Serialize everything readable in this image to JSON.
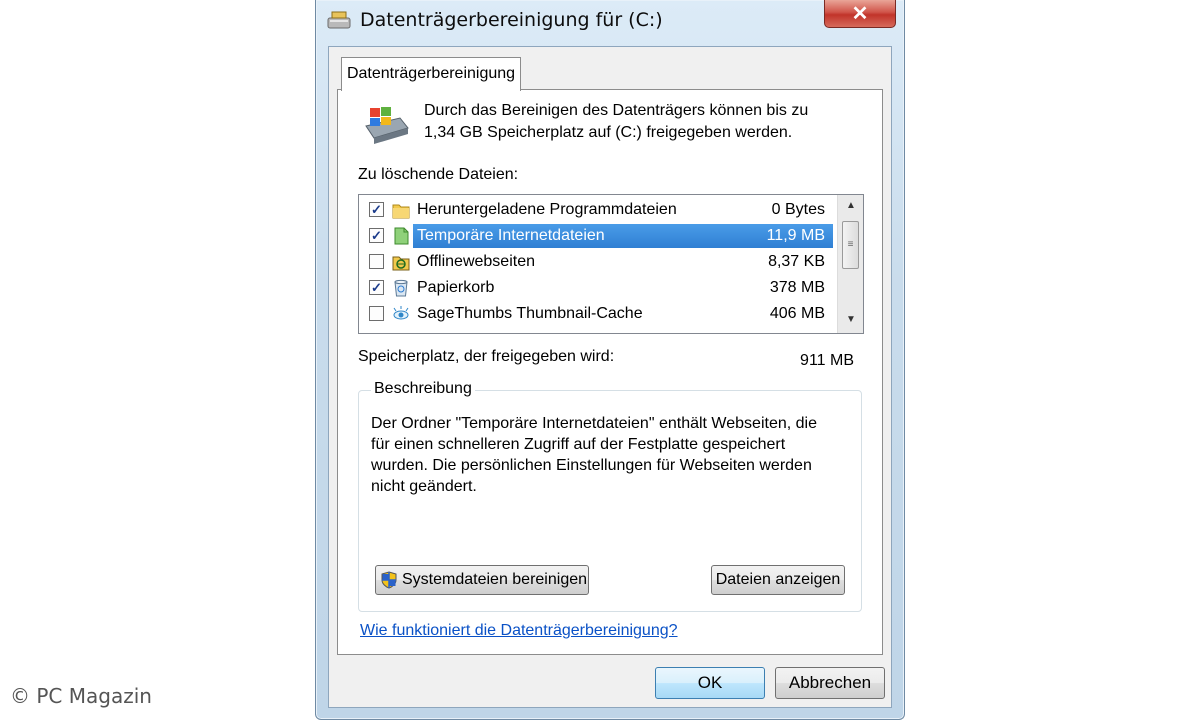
{
  "window": {
    "title": "Datenträgerbereinigung für  (C:)",
    "close_label": "✕"
  },
  "tab": {
    "label": "Datenträgerbereinigung"
  },
  "intro": {
    "text_line1": "Durch das Bereinigen des Datenträgers können bis zu",
    "text_line2": "1,34 GB Speicherplatz auf  (C:) freigegeben werden."
  },
  "files": {
    "label": "Zu löschende Dateien:",
    "items": [
      {
        "name": "Heruntergeladene Programmdateien",
        "size": "0 Bytes",
        "checked": true,
        "icon": "folder-icon"
      },
      {
        "name": "Temporäre Internetdateien",
        "size": "11,9 MB",
        "checked": true,
        "icon": "page-icon",
        "selected": true
      },
      {
        "name": "Offlinewebseiten",
        "size": "8,37 KB",
        "checked": false,
        "icon": "offline-folder-icon"
      },
      {
        "name": "Papierkorb",
        "size": "378 MB",
        "checked": true,
        "icon": "recycle-bin-icon"
      },
      {
        "name": "SageThumbs Thumbnail-Cache",
        "size": "406 MB",
        "checked": false,
        "icon": "thumbnail-cache-icon"
      }
    ]
  },
  "space": {
    "label": "Speicherplatz, der freigegeben wird:",
    "value": "911 MB"
  },
  "description": {
    "title": "Beschreibung",
    "line1": "Der Ordner \"Temporäre Internetdateien\" enthält Webseiten, die",
    "line2": "für einen schnelleren Zugriff auf der Festplatte gespeichert",
    "line3": "wurden. Die persönlichen Einstellungen für Webseiten werden",
    "line4": "nicht geändert."
  },
  "buttons": {
    "system_cleanup": "Systemdateien bereinigen",
    "show_files": "Dateien anzeigen",
    "ok": "OK",
    "cancel": "Abbrechen"
  },
  "help_link": "Wie funktioniert die Datenträgerbereinigung?",
  "watermark": "© PC Magazin",
  "colors": {
    "selection": "#3399ff",
    "link": "#0a51c6",
    "close": "#c1342a"
  }
}
